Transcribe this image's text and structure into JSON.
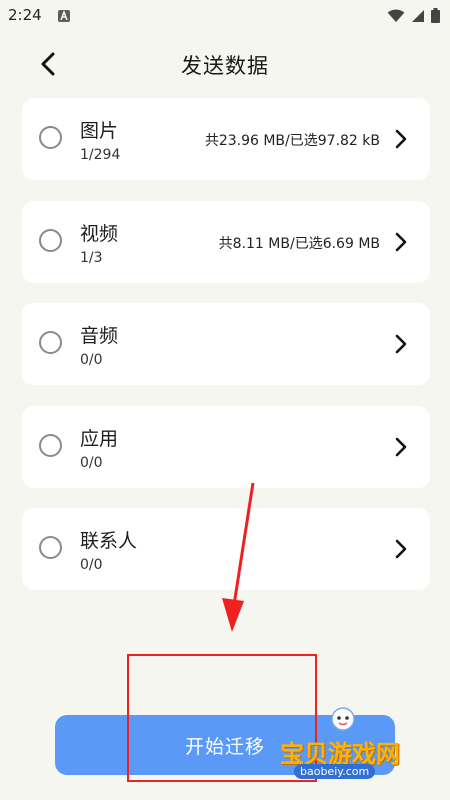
{
  "status_bar": {
    "time": "2:24"
  },
  "header": {
    "title": "发送数据"
  },
  "categories": [
    {
      "name": "图片",
      "count": "1/294",
      "size": "共23.96 MB/已选97.82 kB"
    },
    {
      "name": "视频",
      "count": "1/3",
      "size": "共8.11 MB/已选6.69 MB"
    },
    {
      "name": "音频",
      "count": "0/0",
      "size": ""
    },
    {
      "name": "应用",
      "count": "0/0",
      "size": ""
    },
    {
      "name": "联系人",
      "count": "0/0",
      "size": ""
    }
  ],
  "start_button": {
    "label": "开始迁移"
  },
  "watermark": {
    "text": "宝贝游戏网",
    "url": "baobeiy.com"
  },
  "colors": {
    "accent": "#5a9af6",
    "annotation": "#ee2020",
    "background": "#f6f6f1"
  }
}
